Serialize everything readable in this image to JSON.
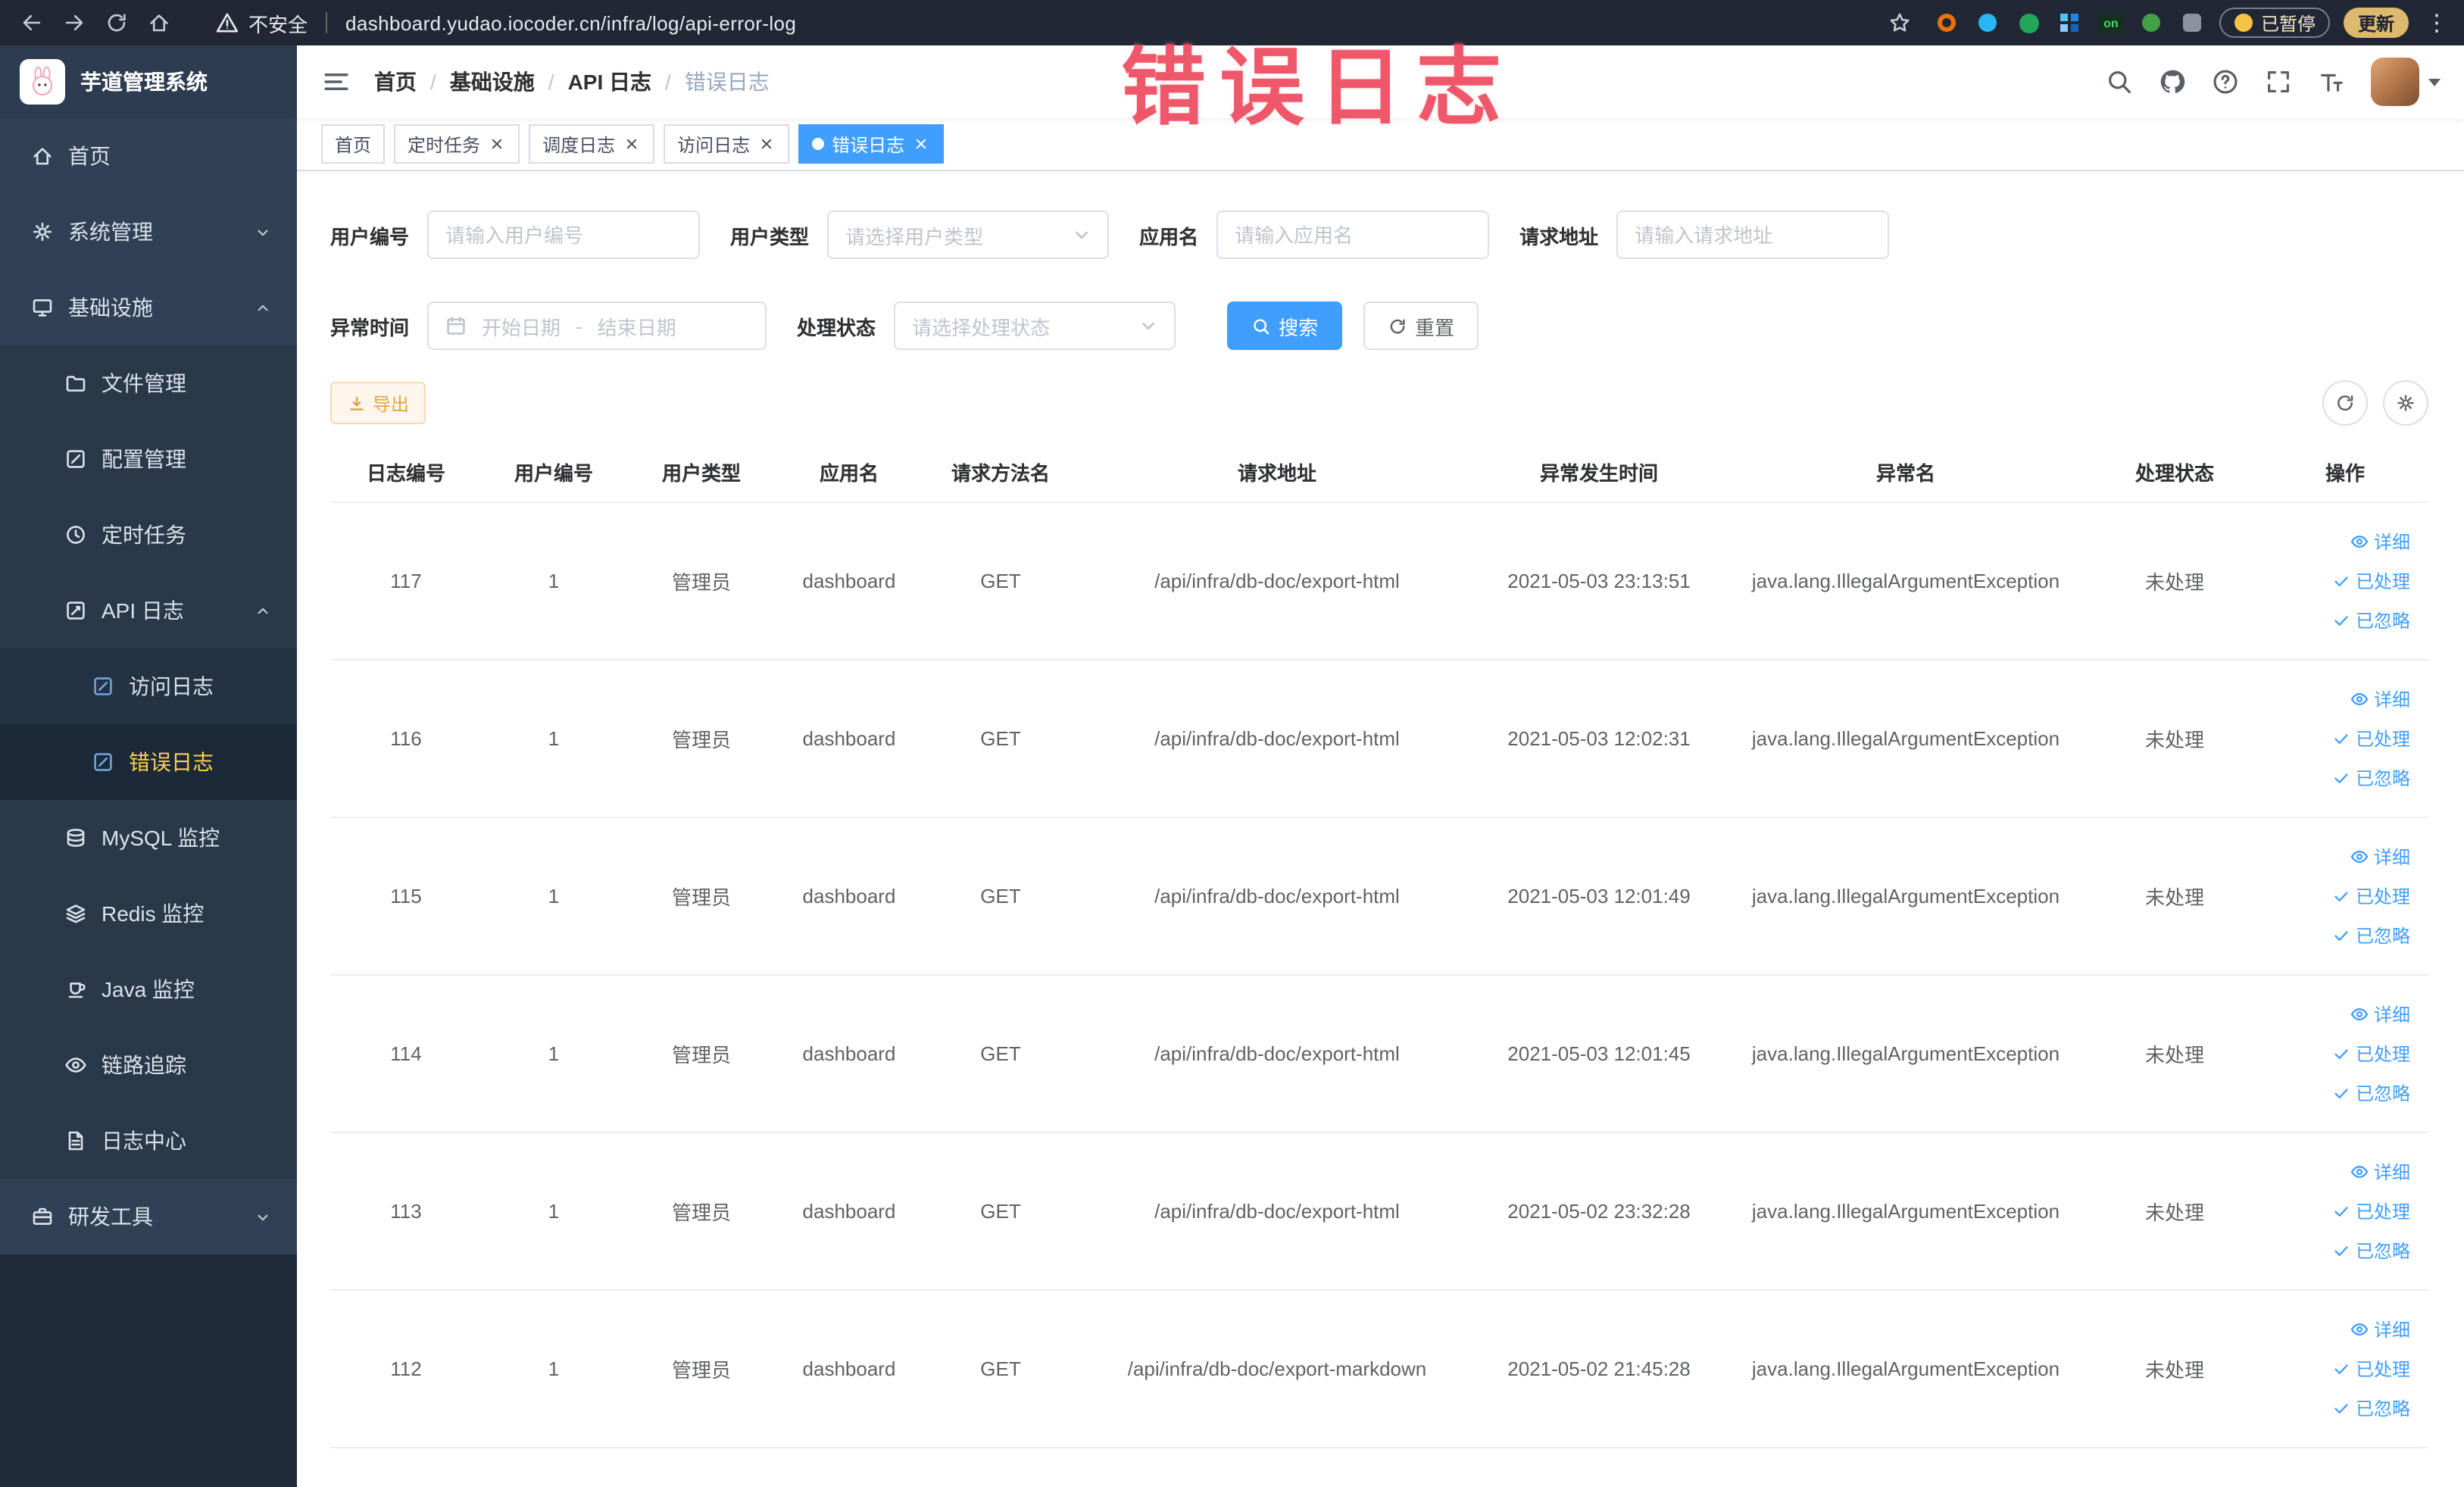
{
  "colors": {
    "primary": "#409eff",
    "sidebar_bg": "#304156",
    "active_menu_text": "#ffd04b",
    "warning": "#e6a23c",
    "annotation_red": "#ec3e54"
  },
  "browser": {
    "security_label": "不安全",
    "url": "dashboard.yudao.iocoder.cn/infra/log/api-error-log",
    "paused_badge": "已暂停",
    "update_button": "更新",
    "ext_on_badge": "on"
  },
  "annotation": {
    "text": "错误日志"
  },
  "sidebar": {
    "logo_title": "芋道管理系统",
    "items": [
      {
        "label": "首页"
      },
      {
        "label": "系统管理"
      },
      {
        "label": "基础设施"
      },
      {
        "label": "文件管理"
      },
      {
        "label": "配置管理"
      },
      {
        "label": "定时任务"
      },
      {
        "label": "API 日志"
      },
      {
        "label": "访问日志"
      },
      {
        "label": "错误日志"
      },
      {
        "label": "MySQL 监控"
      },
      {
        "label": "Redis 监控"
      },
      {
        "label": "Java 监控"
      },
      {
        "label": "链路追踪"
      },
      {
        "label": "日志中心"
      },
      {
        "label": "研发工具"
      }
    ]
  },
  "breadcrumb": {
    "items": [
      "首页",
      "基础设施",
      "API 日志",
      "错误日志"
    ],
    "separator": "/"
  },
  "tabs": [
    {
      "label": "首页"
    },
    {
      "label": "定时任务"
    },
    {
      "label": "调度日志"
    },
    {
      "label": "访问日志"
    },
    {
      "label": "错误日志"
    }
  ],
  "filters": {
    "user_id": {
      "label": "用户编号",
      "placeholder": "请输入用户编号"
    },
    "user_type": {
      "label": "用户类型",
      "placeholder": "请选择用户类型"
    },
    "app_name": {
      "label": "应用名",
      "placeholder": "请输入应用名"
    },
    "request_url": {
      "label": "请求地址",
      "placeholder": "请输入请求地址"
    },
    "exception_time": {
      "label": "异常时间",
      "start_placeholder": "开始日期",
      "end_placeholder": "结束日期",
      "separator": "-"
    },
    "process_status": {
      "label": "处理状态",
      "placeholder": "请选择处理状态"
    },
    "search_label": "搜索",
    "reset_label": "重置"
  },
  "toolbar": {
    "export_label": "导出"
  },
  "table": {
    "columns": [
      "日志编号",
      "用户编号",
      "用户类型",
      "应用名",
      "请求方法名",
      "请求地址",
      "异常发生时间",
      "异常名",
      "处理状态",
      "操作"
    ],
    "actions": {
      "detail": "详细",
      "processed": "已处理",
      "ignored": "已忽略"
    },
    "rows": [
      {
        "id": "117",
        "user_id": "1",
        "user_type": "管理员",
        "app": "dashboard",
        "method": "GET",
        "url": "/api/infra/db-doc/export-html",
        "time": "2021-05-03 23:13:51",
        "exception": "java.lang.IllegalArgumentException",
        "status": "未处理"
      },
      {
        "id": "116",
        "user_id": "1",
        "user_type": "管理员",
        "app": "dashboard",
        "method": "GET",
        "url": "/api/infra/db-doc/export-html",
        "time": "2021-05-03 12:02:31",
        "exception": "java.lang.IllegalArgumentException",
        "status": "未处理"
      },
      {
        "id": "115",
        "user_id": "1",
        "user_type": "管理员",
        "app": "dashboard",
        "method": "GET",
        "url": "/api/infra/db-doc/export-html",
        "time": "2021-05-03 12:01:49",
        "exception": "java.lang.IllegalArgumentException",
        "status": "未处理"
      },
      {
        "id": "114",
        "user_id": "1",
        "user_type": "管理员",
        "app": "dashboard",
        "method": "GET",
        "url": "/api/infra/db-doc/export-html",
        "time": "2021-05-03 12:01:45",
        "exception": "java.lang.IllegalArgumentException",
        "status": "未处理"
      },
      {
        "id": "113",
        "user_id": "1",
        "user_type": "管理员",
        "app": "dashboard",
        "method": "GET",
        "url": "/api/infra/db-doc/export-html",
        "time": "2021-05-02 23:32:28",
        "exception": "java.lang.IllegalArgumentException",
        "status": "未处理"
      },
      {
        "id": "112",
        "user_id": "1",
        "user_type": "管理员",
        "app": "dashboard",
        "method": "GET",
        "url": "/api/infra/db-doc/export-markdown",
        "time": "2021-05-02 21:45:28",
        "exception": "java.lang.IllegalArgumentException",
        "status": "未处理"
      }
    ]
  }
}
